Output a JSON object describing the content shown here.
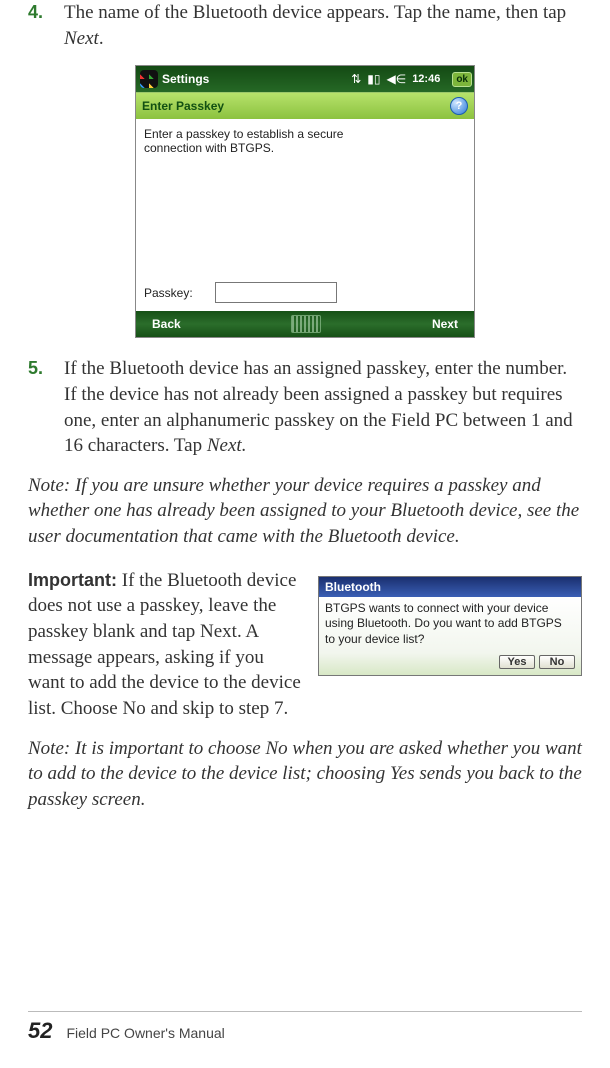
{
  "steps": {
    "s4": {
      "num": "4.",
      "text_a": "The name of the Bluetooth device appears. Tap the name, then tap ",
      "text_b": "Next",
      "text_c": "."
    },
    "s5": {
      "num": "5.",
      "text_a": "If the Bluetooth device has an assigned passkey, enter the number. If the device has not already been assigned a passkey but requires one, enter an alphanumeric passkey on the Field PC between 1 and 16 characters. Tap ",
      "text_b": "Next.",
      "text_c": ""
    }
  },
  "device1": {
    "title": "Settings",
    "time": "12:46",
    "ok": "ok",
    "sub": "Enter Passkey",
    "body_line1": "Enter a passkey to establish a secure",
    "body_line2": "connection with BTGPS.",
    "passkey_label": "Passkey:",
    "back": "Back",
    "next": "Next"
  },
  "note1": "Note: If you are unsure whether your device requires a passkey and whether one has already been assigned to your Bluetooth device, see the user documentation that came with the Bluetooth device.",
  "important": {
    "label": "Important:",
    "text": " If the Bluetooth device does not use a passkey, leave the passkey blank and tap Next. A message appears, asking if you want to add the device to the device list. Choose No and skip to step 7."
  },
  "popup": {
    "title": "Bluetooth",
    "body": "BTGPS wants to connect with your device using Bluetooth. Do you want to add BTGPS to your device list?",
    "yes": "Yes",
    "no": "No"
  },
  "note2": "Note: It is important to choose No when you are asked whether you want to add to the device to the device list; choosing Yes sends you back to the passkey screen.",
  "footer": {
    "page": "52",
    "text": "Field PC Owner's Manual"
  }
}
